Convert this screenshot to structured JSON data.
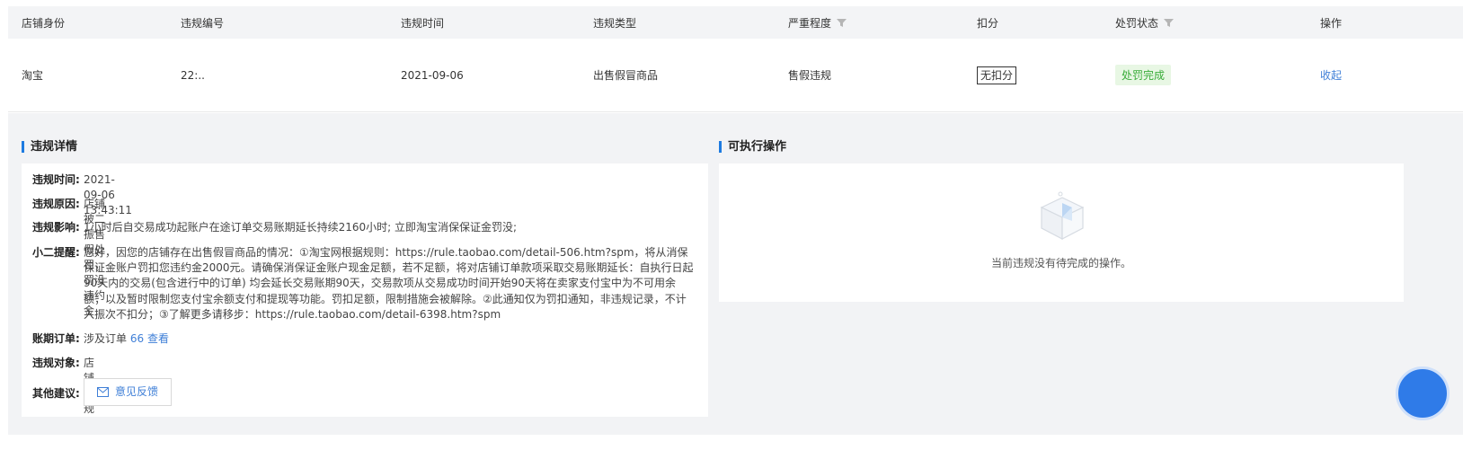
{
  "table": {
    "headers": {
      "shop_identity": "店铺身份",
      "violation_no": "违规编号",
      "violation_time": "违规时间",
      "violation_type": "违规类型",
      "severity": "严重程度",
      "deduction": "扣分",
      "penalty_status": "处罚状态",
      "operation": "操作"
    },
    "row": {
      "shop_identity": "淘宝",
      "violation_no": "22:..",
      "violation_time": "2021-09-06",
      "violation_type": "出售假冒商品",
      "severity": "售假违规",
      "deduction": "无扣分",
      "penalty_status": "处罚完成",
      "operation": "收起"
    }
  },
  "detail": {
    "title": "违规详情",
    "time_label": "违规时间:",
    "time_value": "2021-09-06 13:43:11",
    "reason_label": "违规原因:",
    "reason_value": "店铺被二振售假处罚，罚没违约金",
    "impact_label": "违规影响:",
    "impact_value": "1小时后自交易成功起账户在途订单交易账期延长持续2160小时; 立即淘宝消保保证金罚没;",
    "reminder_label": "小二提醒:",
    "reminder_value": "您好，因您的店铺存在出售假冒商品的情况：①淘宝网根据规则：https://rule.taobao.com/detail-506.htm?spm，将从消保保证金账户罚扣您违约金2000元。请确保消保证金账户现金足额，若不足额，将对店铺订单款项采取交易账期延长：自执行日起90天内的交易(包含进行中的订单) 均会延长交易账期90天，交易款项从交易成功时间开始90天将在卖家支付宝中为不可用余额；以及暂时限制您支付宝余额支付和提现等功能。罚扣足额，限制措施会被解除。②此通知仅为罚扣通知，非违规记录，不计入振次不扣分；③了解更多请移步：https://rule.taobao.com/detail-6398.htm?spm",
    "orders_label": "账期订单:",
    "orders_prefix": "涉及订单",
    "orders_count": "66",
    "orders_link": "查看",
    "object_label": "违规对象:",
    "object_value": "店铺违规",
    "suggest_label": "其他建议:",
    "feedback_button": "意见反馈"
  },
  "actions": {
    "title": "可执行操作",
    "empty_text": "当前违规没有待完成的操作。"
  },
  "colors": {
    "accent": "#1e7be0",
    "link": "#3f7fd7",
    "status_green": "#3aad3a",
    "panel_bg": "#f2f3f5"
  }
}
